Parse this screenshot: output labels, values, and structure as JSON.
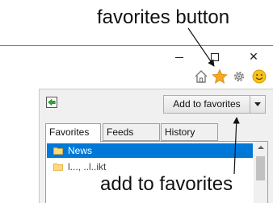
{
  "annotations": {
    "top_callout": "favorites button",
    "bottom_callout": "add to favorites"
  },
  "window_controls": {
    "minimize_icon": "minimize-icon",
    "maximize_icon": "maximize-icon",
    "close_glyph": "✕"
  },
  "toolbar": {
    "icons": [
      "home-icon",
      "star-icon",
      "gear-icon",
      "smiley-icon"
    ],
    "star_color": "#f5a623"
  },
  "favorites_panel": {
    "pin_icon": "pin-green-arrow-icon",
    "add_button_label": "Add to favorites",
    "tabs": [
      {
        "label": "Favorites",
        "selected": true
      },
      {
        "label": "Feeds",
        "selected": false
      },
      {
        "label": "History",
        "selected": false
      }
    ],
    "items": [
      {
        "label": "News",
        "selected": true
      },
      {
        "label": "l..., ..l..ikt",
        "selected": false
      }
    ],
    "selection_color": "#0078d7"
  }
}
